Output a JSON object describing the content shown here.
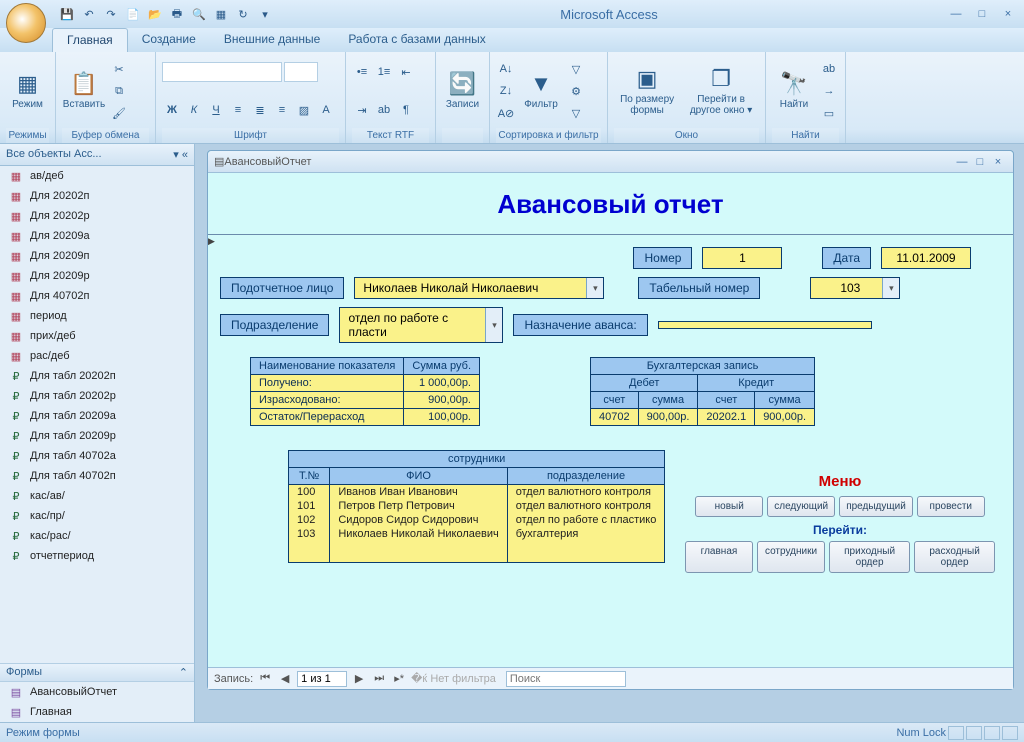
{
  "app_title": "Microsoft Access",
  "ribbon": {
    "tabs": [
      "Главная",
      "Создание",
      "Внешние данные",
      "Работа с базами данных"
    ],
    "groups": {
      "rezhimy": {
        "label": "Режимы",
        "big": "Режим"
      },
      "bufer": {
        "label": "Буфер обмена",
        "big": "Вставить"
      },
      "shrift": {
        "label": "Шрифт"
      },
      "tekst": {
        "label": "Текст RTF"
      },
      "zapisi": {
        "label": "",
        "big": "Записи"
      },
      "sortirovka": {
        "label": "Сортировка и фильтр",
        "big": "Фильтр"
      },
      "okno": {
        "label": "Окно",
        "big1": "По размеру формы",
        "big2": "Перейти в другое окно ▾"
      },
      "nayti": {
        "label": "Найти",
        "big": "Найти"
      }
    }
  },
  "nav": {
    "header": "Все объекты Acc...",
    "queries": [
      "ав/деб",
      "Для 20202п",
      "Для 20202р",
      "Для 20209а",
      "Для 20209п",
      "Для 20209р",
      "Для 40702п",
      "период",
      "прих/деб",
      "рас/деб",
      "Для табл 20202п",
      "Для табл 20202р",
      "Для табл 20209а",
      "Для табл 20209р",
      "Для табл 40702а",
      "Для табл 40702п",
      "кас/ав/",
      "кас/пр/",
      "кас/рас/",
      "отчетпериод"
    ],
    "forms_header": "Формы",
    "forms": [
      "АвансовыйОтчет",
      "Главная"
    ]
  },
  "form": {
    "window_title": "АвансовыйОтчет",
    "title": "Авансовый отчет",
    "labels": {
      "nomer": "Номер",
      "data": "Дата",
      "lico": "Подотчетное лицо",
      "tabel": "Табельный номер",
      "podr": "Подразделение",
      "nazn": "Назначение аванса:"
    },
    "values": {
      "nomer": "1",
      "data": "11.01.2009",
      "lico": "Николаев Николай Николаевич",
      "tabel": "103",
      "podr": "отдел по работе с пласти",
      "nazn": ""
    },
    "indicators": {
      "headers": [
        "Наименование показателя",
        "Сумма руб."
      ],
      "rows": [
        [
          "Получено:",
          "1 000,00р."
        ],
        [
          "Израсходовано:",
          "900,00р."
        ],
        [
          "Остаток/Перерасход",
          "100,00р."
        ]
      ]
    },
    "bukh": {
      "title": "Бухгалтерская запись",
      "debet": "Дебет",
      "kredit": "Кредит",
      "schet": "счет",
      "summa": "сумма",
      "row": [
        "40702",
        "900,00р.",
        "20202.1",
        "900,00р."
      ]
    },
    "employees": {
      "title": "сотрудники",
      "headers": [
        "Т.№",
        "ФИО",
        "подразделение"
      ],
      "rows": [
        [
          "100",
          "Иванов Иван Иванович",
          "отдел валютного контроля"
        ],
        [
          "101",
          "Петров Петр Петрович",
          "отдел валютного контроля"
        ],
        [
          "102",
          "Сидоров Сидор Сидорович",
          "отдел по работе с пластико"
        ],
        [
          "103",
          "Николаев Николай Николаевич",
          "бухгалтерия"
        ]
      ]
    },
    "menu": {
      "title": "Меню",
      "sub": "Перейти:",
      "row1": [
        "новый",
        "следующий",
        "предыдущий",
        "провести"
      ],
      "row2": [
        "главная",
        "сотрудники",
        "приходный ордер",
        "расходный ордер"
      ]
    },
    "recnav": {
      "label": "Запись:",
      "pos": "1 из 1",
      "filter": "Нет фильтра",
      "search": "Поиск"
    }
  },
  "status": {
    "left": "Режим формы",
    "right": "Num Lock"
  }
}
